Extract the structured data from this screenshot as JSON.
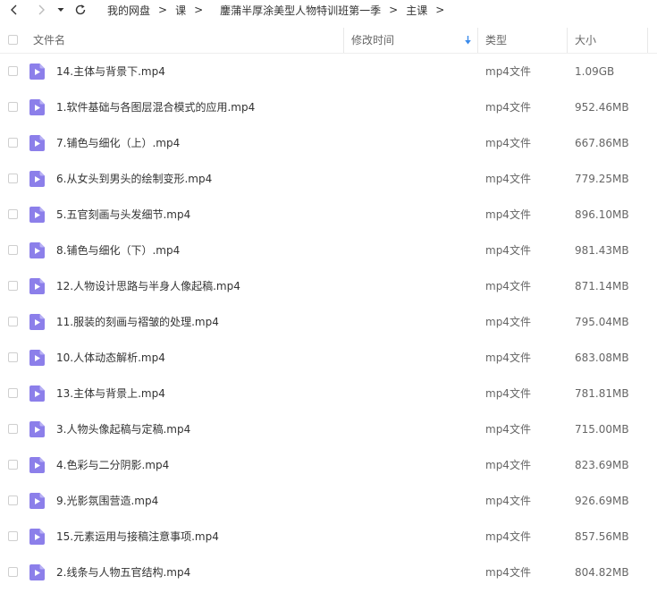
{
  "breadcrumb": {
    "items": [
      "我的网盘",
      "课",
      "鏖蒲半厚涂美型人物特训班第一季",
      "主课"
    ],
    "separator": ">"
  },
  "table": {
    "headers": {
      "name": "文件名",
      "modified": "修改时间",
      "type": "类型",
      "size": "大小"
    },
    "sort_icon": "sort-down-arrow-icon",
    "rows": [
      {
        "name": "14.主体与背景下.mp4",
        "type": "mp4文件",
        "size": "1.09GB"
      },
      {
        "name": "1.软件基础与各图层混合模式的应用.mp4",
        "type": "mp4文件",
        "size": "952.46MB"
      },
      {
        "name": "7.铺色与细化（上）.mp4",
        "type": "mp4文件",
        "size": "667.86MB"
      },
      {
        "name": "6.从女头到男头的绘制变形.mp4",
        "type": "mp4文件",
        "size": "779.25MB"
      },
      {
        "name": "5.五官刻画与头发细节.mp4",
        "type": "mp4文件",
        "size": "896.10MB"
      },
      {
        "name": "8.铺色与细化（下）.mp4",
        "type": "mp4文件",
        "size": "981.43MB"
      },
      {
        "name": "12.人物设计思路与半身人像起稿.mp4",
        "type": "mp4文件",
        "size": "871.14MB"
      },
      {
        "name": "11.服装的刻画与褶皱的处理.mp4",
        "type": "mp4文件",
        "size": "795.04MB"
      },
      {
        "name": "10.人体动态解析.mp4",
        "type": "mp4文件",
        "size": "683.08MB"
      },
      {
        "name": "13.主体与背景上.mp4",
        "type": "mp4文件",
        "size": "781.81MB"
      },
      {
        "name": "3.人物头像起稿与定稿.mp4",
        "type": "mp4文件",
        "size": "715.00MB"
      },
      {
        "name": "4.色彩与二分阴影.mp4",
        "type": "mp4文件",
        "size": "823.69MB"
      },
      {
        "name": "9.光影氛围营造.mp4",
        "type": "mp4文件",
        "size": "926.69MB"
      },
      {
        "name": "15.元素运用与接稿注意事项.mp4",
        "type": "mp4文件",
        "size": "857.56MB"
      },
      {
        "name": "2.线条与人物五官结构.mp4",
        "type": "mp4文件",
        "size": "804.82MB"
      }
    ]
  },
  "colors": {
    "video_icon": "#8c7fea",
    "sort_arrow": "#3b8beb"
  }
}
